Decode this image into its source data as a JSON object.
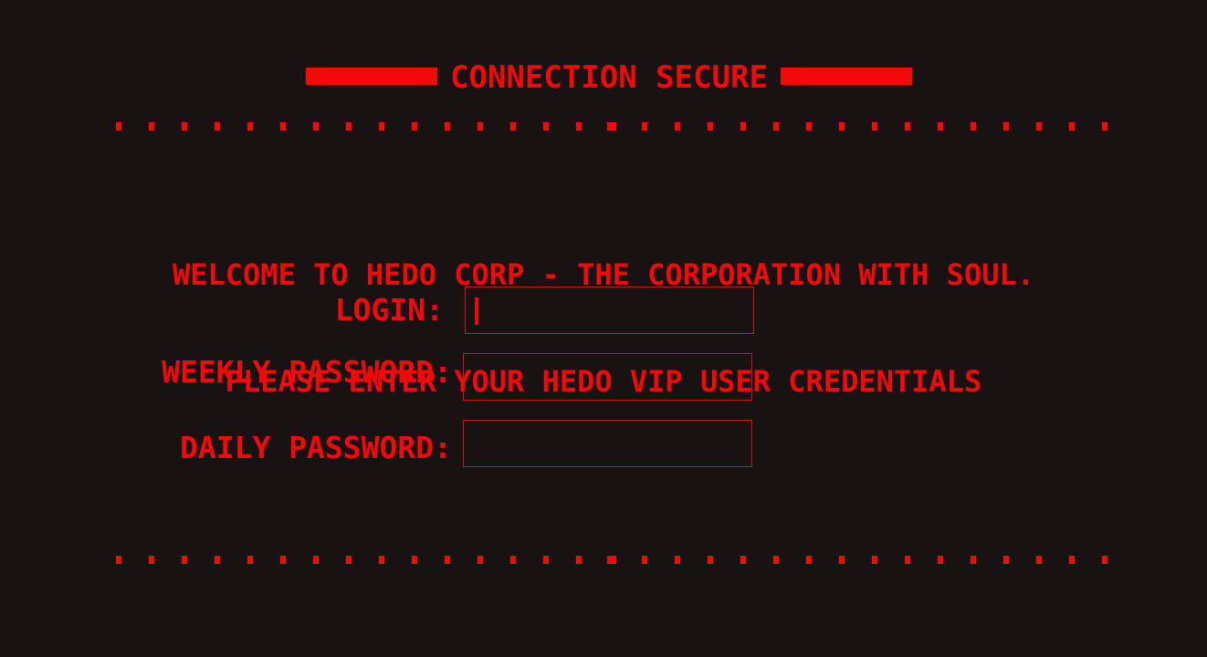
{
  "header": {
    "title": "CONNECTION SECURE"
  },
  "welcome": {
    "line1": "WELCOME TO HEDO CORP - THE CORPORATION WITH SOUL.",
    "line2": "PLEASE ENTER YOUR HEDO VIP USER CREDENTIALS"
  },
  "form": {
    "login_label": "LOGIN:",
    "login_value": "",
    "weekly_label": "WEEKLY PASSWORD:",
    "weekly_value": "",
    "daily_label": "DAILY PASSWORD:",
    "daily_value": ""
  },
  "colors": {
    "background": "#181213",
    "accent": "#f20a0a"
  }
}
